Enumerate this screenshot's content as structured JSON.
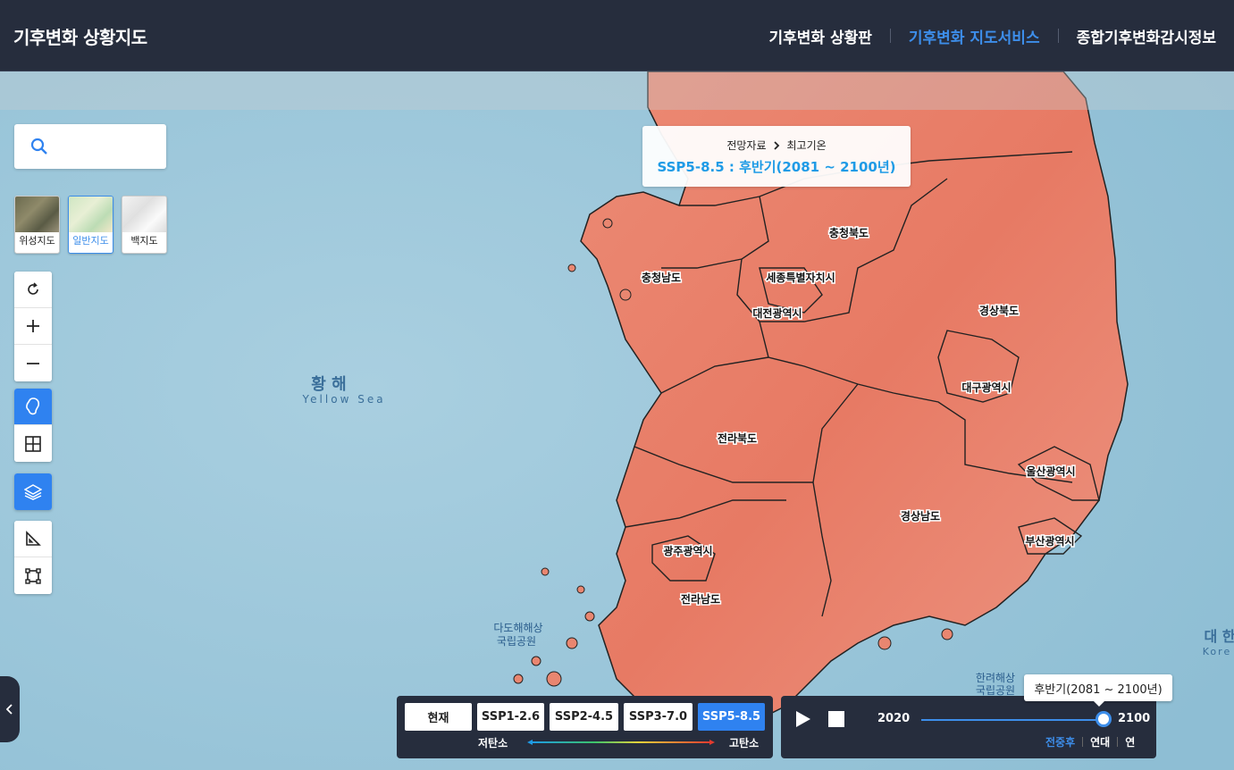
{
  "header": {
    "brand": "기후변화 상황지도",
    "nav": [
      {
        "label": "기후변화 상황판",
        "active": false
      },
      {
        "label": "기후변화 지도서비스",
        "active": true
      },
      {
        "label": "종합기후변화감시정보",
        "active": false
      }
    ]
  },
  "search": {
    "placeholder": ""
  },
  "basemaps": [
    {
      "label": "위성지도",
      "active": false
    },
    {
      "label": "일반지도",
      "active": true
    },
    {
      "label": "백지도",
      "active": false
    }
  ],
  "info": {
    "category": "전망자료",
    "variable": "최고기온",
    "scenario_text": "SSP5-8.5 : 후반기(2081 ~ 2100년)"
  },
  "scenarios": {
    "buttons": [
      {
        "label": "현재",
        "active": false
      },
      {
        "label": "SSP1-2.6",
        "active": false
      },
      {
        "label": "SSP2-4.5",
        "active": false
      },
      {
        "label": "SSP3-7.0",
        "active": false
      },
      {
        "label": "SSP5-8.5",
        "active": true
      }
    ],
    "low_label": "저탄소",
    "high_label": "고탄소"
  },
  "timeline": {
    "start": "2020",
    "end": "2100",
    "value_fraction": 1.0,
    "tooltip": "후반기(2081 ~ 2100년)",
    "modes": [
      {
        "label": "전중후",
        "active": true
      },
      {
        "label": "연대",
        "active": false
      },
      {
        "label": "연",
        "active": false
      }
    ]
  },
  "map_labels": {
    "provinces": [
      "충청북도",
      "충청남도",
      "세종특별자치시",
      "대전광역시",
      "경상북도",
      "대구광역시",
      "전라북도",
      "울산광역시",
      "경상남도",
      "부산광역시",
      "광주광역시",
      "전라남도"
    ],
    "sea_kr": "황 해",
    "sea_en": "Yellow Sea",
    "east_kr": "대 한",
    "east_en": "Kore",
    "park1": "다도해해상",
    "park1b": "국립공원",
    "park2": "한려해상",
    "park2b": "국립공원"
  },
  "colors": {
    "accent": "#2f82f0",
    "header_bg": "#262d3d",
    "land": "#e9806a",
    "sea": "#9cc6da",
    "scenario_text": "#1e9be6"
  }
}
